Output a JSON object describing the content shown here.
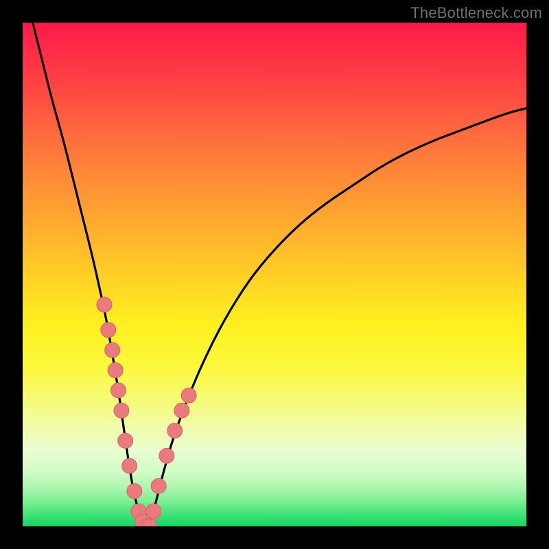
{
  "watermark": {
    "text": "TheBottleneck.com"
  },
  "colors": {
    "background": "#000000",
    "curve": "#000000",
    "marker_fill": "#e97a7d",
    "marker_stroke": "#d46568",
    "gradient_top": "#ff1a4a",
    "gradient_bottom": "#17d763"
  },
  "chart_data": {
    "type": "line",
    "title": "",
    "xlabel": "",
    "ylabel": "",
    "xlim": [
      0,
      100
    ],
    "ylim": [
      0,
      100
    ],
    "grid": false,
    "legend": false,
    "series": [
      {
        "name": "bottleneck-curve",
        "x": [
          2,
          4,
          6,
          8,
          10,
          12,
          14,
          16,
          17,
          18,
          19,
          20,
          21,
          22,
          23,
          24,
          25,
          26,
          28,
          30,
          33,
          36,
          40,
          45,
          50,
          55,
          60,
          66,
          72,
          80,
          88,
          96,
          100
        ],
        "y": [
          100,
          92,
          84,
          77,
          69,
          61,
          53,
          44,
          39,
          33,
          27,
          20,
          13,
          7,
          3,
          0,
          0,
          3,
          11,
          18,
          26,
          33,
          41,
          49,
          55,
          60,
          64,
          68,
          72,
          76,
          79,
          82,
          83
        ]
      },
      {
        "name": "sample-markers",
        "x": [
          16.2,
          17.0,
          17.8,
          18.4,
          19.0,
          19.6,
          20.4,
          21.2,
          22.2,
          23.0,
          23.8,
          24.6,
          25.2,
          26.0,
          27.0,
          28.6,
          30.2,
          31.6,
          33.0
        ],
        "y": [
          44,
          39,
          35,
          31,
          27,
          23,
          17,
          12,
          7,
          3,
          1,
          0,
          0,
          3,
          8,
          14,
          19,
          23,
          26
        ]
      }
    ],
    "annotations": [
      {
        "text": "TheBottleneck.com",
        "position": "top-right"
      }
    ]
  }
}
